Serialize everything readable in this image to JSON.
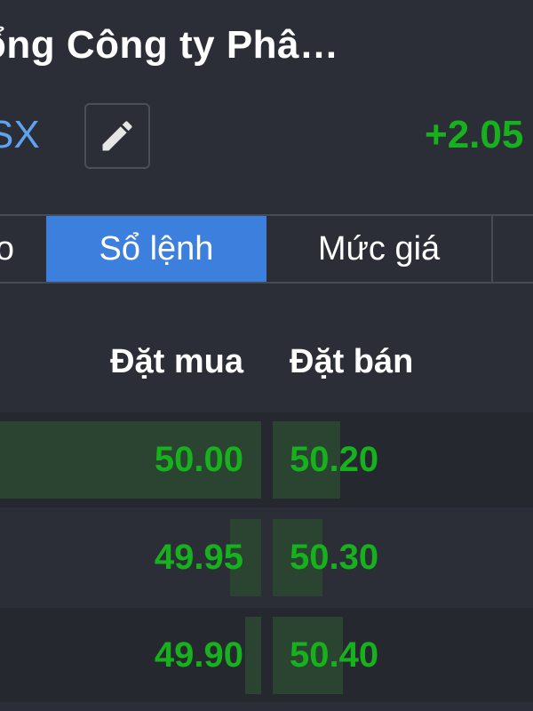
{
  "header": {
    "company_name": "ổng Công ty Phâ…",
    "exchange": "SX",
    "change": "+2.05"
  },
  "tabs": [
    {
      "label": "o"
    },
    {
      "label": "Sổ lệnh",
      "active": true
    },
    {
      "label": "Mức giá"
    },
    {
      "label": ""
    }
  ],
  "order_book": {
    "bid_header": "Đặt mua",
    "ask_header": "Đặt bán",
    "rows": [
      {
        "bid": "50.00",
        "ask": "50.20",
        "bid_volume_fraction": 1.0,
        "ask_volume_fraction": 0.26
      },
      {
        "bid": "49.95",
        "ask": "50.30",
        "bid_volume_fraction": 0.12,
        "ask_volume_fraction": 0.19
      },
      {
        "bid": "49.90",
        "ask": "50.40",
        "bid_volume_fraction": 0.06,
        "ask_volume_fraction": 0.27
      }
    ]
  },
  "colors": {
    "background": "#2b2e36",
    "accent": "#3d7fdc",
    "positive": "#16b11d",
    "link": "#5fa3f0",
    "volume_bar": "#2a4431"
  },
  "icons": {
    "edit": "pencil-icon"
  }
}
